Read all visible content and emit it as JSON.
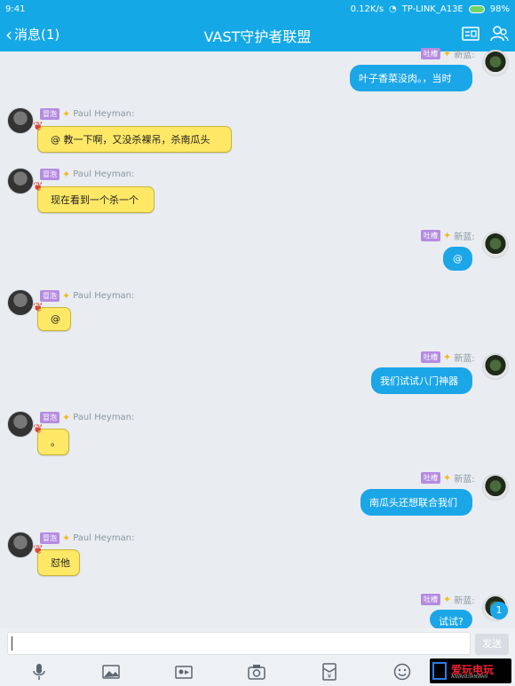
{
  "status_bar": {
    "time": "9:41",
    "network_speed": "0.12K/s",
    "wifi_name": "TP-LINK_A13E",
    "battery": "98%"
  },
  "header": {
    "back_label": "消息(1)",
    "title": "VAST守护者联盟",
    "icons": [
      "profile-card-icon",
      "group-members-icon"
    ]
  },
  "messages": [
    {
      "side": "right",
      "tag": "吐槽",
      "sender": "新蓝:",
      "text": "叶子香菜没肉。，当时"
    },
    {
      "side": "left",
      "tag": "冒泡",
      "sender": "Paul Heyman:",
      "text": "@ 教一下啊，又没杀裸吊，杀南瓜头"
    },
    {
      "side": "left",
      "tag": "冒泡",
      "sender": "Paul Heyman:",
      "text": "现在看到一个杀一个"
    },
    {
      "side": "right",
      "tag": "吐槽",
      "sender": "新蓝:",
      "text": "@"
    },
    {
      "side": "left",
      "tag": "冒泡",
      "sender": "Paul Heyman:",
      "text": "@"
    },
    {
      "side": "right",
      "tag": "吐槽",
      "sender": "新蓝:",
      "text": "我们试试八门神器"
    },
    {
      "side": "left",
      "tag": "冒泡",
      "sender": "Paul Heyman:",
      "text": "。"
    },
    {
      "side": "right",
      "tag": "吐槽",
      "sender": "新蓝:",
      "text": "南瓜头还想联合我们"
    },
    {
      "side": "left",
      "tag": "冒泡",
      "sender": "Paul Heyman:",
      "text": "怼他"
    },
    {
      "side": "right",
      "tag": "吐槽",
      "sender": "新蓝:",
      "text": "试试?"
    }
  ],
  "unread_badge": "1",
  "input": {
    "value": "",
    "send_label": "发送"
  },
  "toolbar": {
    "icons": [
      "microphone-icon",
      "image-icon",
      "video-icon",
      "camera-icon",
      "red-packet-icon",
      "emoji-icon",
      "more-icon"
    ]
  },
  "watermark": {
    "text": "爱玩电玩",
    "sub": "AIWANDIANWAN"
  },
  "colors": {
    "header_bg": "#14a8e6",
    "chat_bg": "#e9edf1",
    "left_bubble": "#ffe866",
    "right_bubble": "#1ba6e8",
    "tag_bg": "#b58be0"
  }
}
